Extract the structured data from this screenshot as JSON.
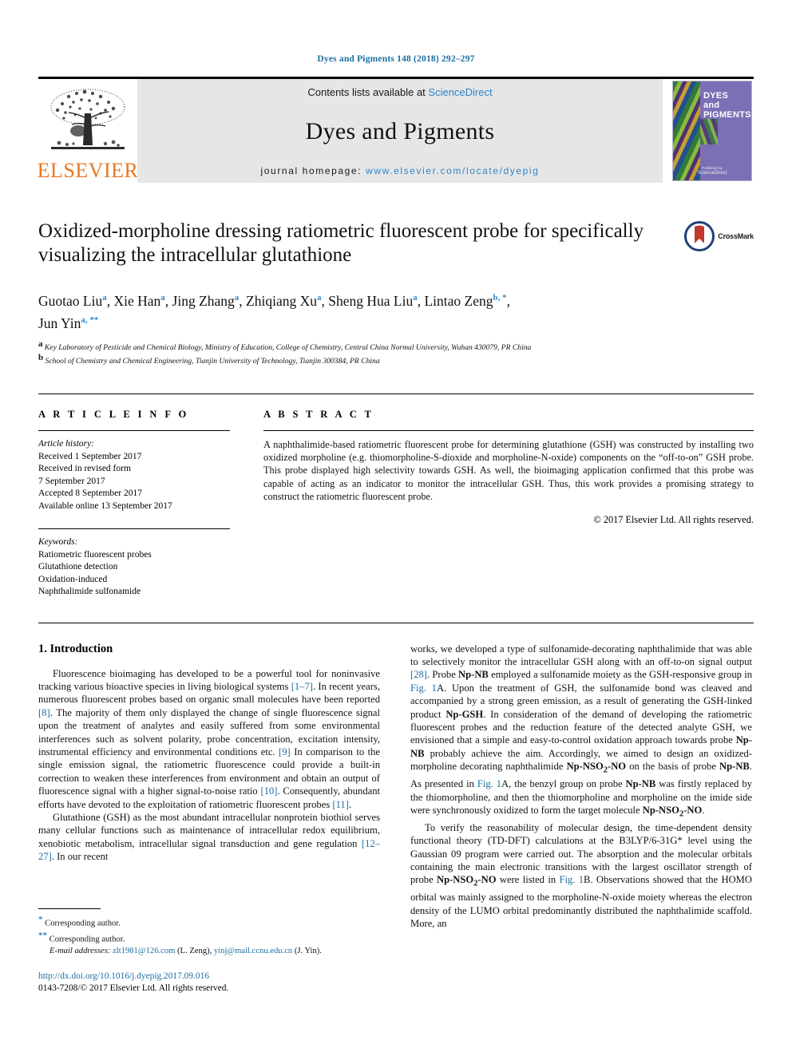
{
  "running_head": "Dyes and Pigments 148 (2018) 292–297",
  "masthead": {
    "publisher_logo_text": "ELSEVIER",
    "contents_prefix": "Contents lists available at ",
    "contents_link": "ScienceDirect",
    "journal_name": "Dyes and Pigments",
    "homepage_prefix": "journal homepage: ",
    "homepage_url": "www.elsevier.com/locate/dyepig",
    "cover": {
      "line1": "DYES",
      "line2": "and",
      "line3": "PIGMENTS",
      "footer_small": "Published by",
      "footer_brand": "ScienceDirect"
    }
  },
  "article": {
    "title": "Oxidized-morpholine dressing ratiometric fluorescent probe for specifically visualizing the intracellular glutathione",
    "crossmark_label": "CrossMark",
    "authors_line1": "Guotao Liu <a>, Xie Han <a>, Jing Zhang <a>, Zhiqiang Xu <a>, Sheng Hua Liu <a>, Lintao Zeng <b,*>,",
    "authors_line2": "Jun Yin <a,**>",
    "authors": [
      {
        "name": "Guotao Liu",
        "sup": "a"
      },
      {
        "name": "Xie Han",
        "sup": "a"
      },
      {
        "name": "Jing Zhang",
        "sup": "a"
      },
      {
        "name": "Zhiqiang Xu",
        "sup": "a"
      },
      {
        "name": "Sheng Hua Liu",
        "sup": "a"
      },
      {
        "name": "Lintao Zeng",
        "sup": "b, *"
      },
      {
        "name": "Jun Yin",
        "sup": "a, **"
      }
    ],
    "affiliations": [
      {
        "marker": "a",
        "text": "Key Laboratory of Pesticide and Chemical Biology, Ministry of Education, College of Chemistry, Central China Normal University, Wuhan 430079, PR China"
      },
      {
        "marker": "b",
        "text": "School of Chemistry and Chemical Engineering, Tianjin University of Technology, Tianjin 300384, PR China"
      }
    ]
  },
  "article_info": {
    "heading": "A R T I C L E  I N F O",
    "history_label": "Article history:",
    "history": [
      "Received 1 September 2017",
      "Received in revised form",
      "7 September 2017",
      "Accepted 8 September 2017",
      "Available online 13 September 2017"
    ],
    "keywords_label": "Keywords:",
    "keywords": [
      "Ratiometric fluorescent probes",
      "Glutathione detection",
      "Oxidation-induced",
      "Naphthalimide sulfonamide"
    ]
  },
  "abstract": {
    "heading": "A B S T R A C T",
    "text": "A naphthalimide-based ratiometric fluorescent probe for determining glutathione (GSH) was constructed by installing two oxidized morpholine (e.g. thiomorpholine-S-dioxide and morpholine-N-oxide) components on the “off-to-on” GSH probe. This probe displayed high selectivity towards GSH. As well, the bioimaging application confirmed that this probe was capable of acting as an indicator to monitor the intracellular GSH. Thus, this work provides a promising strategy to construct the ratiometric fluorescent probe.",
    "copyright": "© 2017 Elsevier Ltd. All rights reserved."
  },
  "body": {
    "section_heading": "1. Introduction",
    "left_paragraphs": [
      "Fluorescence bioimaging has developed to be a powerful tool for noninvasive tracking various bioactive species in living biological systems [1–7]. In recent years, numerous fluorescent probes based on organic small molecules have been reported [8]. The majority of them only displayed the change of single fluorescence signal upon the treatment of analytes and easily suffered from some environmental interferences such as solvent polarity, probe concentration, excitation intensity, instrumental efficiency and environmental conditions etc. [9] In comparison to the single emission signal, the ratiometric fluorescence could provide a built-in correction to weaken these interferences from environment and obtain an output of fluorescence signal with a higher signal-to-noise ratio [10]. Consequently, abundant efforts have devoted to the exploitation of ratiometric fluorescent probes [11].",
      "Glutathione (GSH) as the most abundant intracellular nonprotein biothiol serves many cellular functions such as maintenance of intracellular redox equilibrium, xenobiotic metabolism, intracellular signal transduction and gene regulation [12–27]. In our recent"
    ],
    "right_paragraphs": [
      "works, we developed a type of sulfonamide-decorating naphthalimide that was able to selectively monitor the intracellular GSH along with an off-to-on signal output [28]. Probe Np-NB employed a sulfonamide moiety as the GSH-responsive group in Fig. 1A. Upon the treatment of GSH, the sulfonamide bond was cleaved and accompanied by a strong green emission, as a result of generating the GSH-linked product Np-GSH. In consideration of the demand of developing the ratiometric fluorescent probes and the reduction feature of the detected analyte GSH, we envisioned that a simple and easy-to-control oxidation approach towards probe Np-NB probably achieve the aim. Accordingly, we aimed to design an oxidized-morpholine decorating naphthalimide Np-NSO2-NO on the basis of probe Np-NB. As presented in Fig. 1A, the benzyl group on probe Np-NB was firstly replaced by the thiomorpholine, and then the thiomorpholine and morpholine on the imide side were synchronously oxidized to form the target molecule Np-NSO2-NO.",
      "To verify the reasonability of molecular design, the time-dependent density functional theory (TD-DFT) calculations at the B3LYP/6-31G* level using the Gaussian 09 program were carried out. The absorption and the molecular orbitals containing the main electronic transitions with the largest oscillator strength of probe Np-NSO2-NO were listed in Fig. 1B. Observations showed that the HOMO orbital was mainly assigned to the morpholine-N-oxide moiety whereas the electron density of the LUMO orbital predominantly distributed the naphthalimide scaffold. More, an"
    ]
  },
  "footnotes": {
    "corresponding_1": "Corresponding author.",
    "corresponding_2": "Corresponding author.",
    "email_label": "E-mail addresses:",
    "email_1": "zlt1981@126.com",
    "email_1_who": "(L. Zeng)",
    "email_2": "yinj@mail.ccnu.edu.cn",
    "email_2_who": "(J. Yin).",
    "doi": "http://dx.doi.org/10.1016/j.dyepig.2017.09.016",
    "issn_line": "0143-7208/© 2017 Elsevier Ltd. All rights reserved."
  },
  "colors": {
    "link_blue": "#1a6fa3",
    "sciencedirect_blue": "#2e86c9",
    "elsevier_orange": "#E87722",
    "panel_grey": "#e6e6e6",
    "cover_purple": "#7b6fb5"
  }
}
